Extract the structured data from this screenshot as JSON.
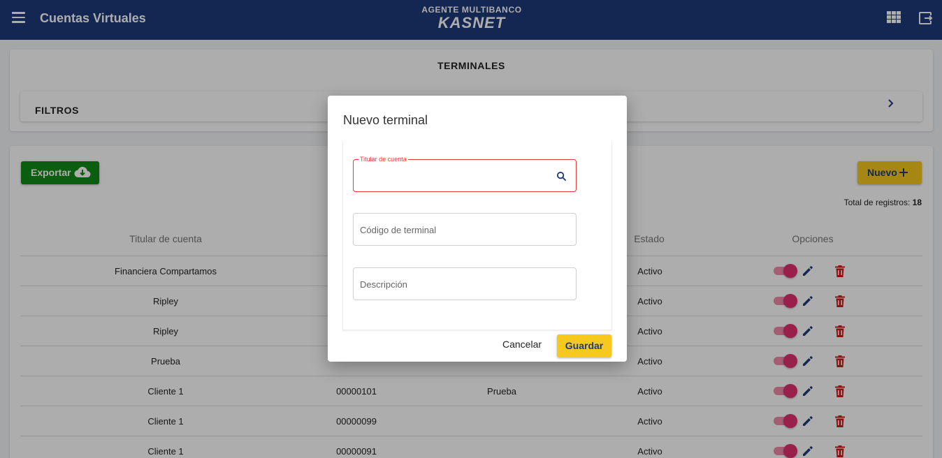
{
  "header": {
    "title": "Cuentas Virtuales",
    "logo_top": "AGENTE MULTIBANCO",
    "logo_main": "KASNET"
  },
  "top_card": {
    "title": "TERMINALES",
    "filters_label": "FILTROS"
  },
  "toolbar": {
    "export_label": "Exportar",
    "new_label": "Nuevo",
    "total_label": "Total de registros:",
    "total_value": "18"
  },
  "table": {
    "headers": {
      "holder": "Titular de cuenta",
      "status": "Estado",
      "options": "Opciones"
    },
    "rows": [
      {
        "holder": "Financiera Compartamos",
        "code": "",
        "description": "",
        "status": "Activo",
        "enabled": true
      },
      {
        "holder": "Ripley",
        "code": "",
        "description": "",
        "status": "Activo",
        "enabled": true
      },
      {
        "holder": "Ripley",
        "code": "",
        "description": "",
        "status": "Activo",
        "enabled": true
      },
      {
        "holder": "Prueba",
        "code": "",
        "description": "",
        "status": "Activo",
        "enabled": true
      },
      {
        "holder": "Cliente 1",
        "code": "00000101",
        "description": "Prueba",
        "status": "Activo",
        "enabled": true
      },
      {
        "holder": "Cliente 1",
        "code": "00000099",
        "description": "",
        "status": "Activo",
        "enabled": true
      },
      {
        "holder": "Cliente 1",
        "code": "00000091",
        "description": "",
        "status": "Activo",
        "enabled": true
      }
    ]
  },
  "dialog": {
    "title": "Nuevo terminal",
    "holder_float_label": "Titular de cuenta",
    "holder_value": "",
    "code_placeholder": "Código de terminal",
    "description_placeholder": "Descripción",
    "cancel_label": "Cancelar",
    "save_label": "Guardar"
  },
  "colors": {
    "header_bg": "#1e3a7b",
    "export_green": "#118a17",
    "accent_yellow": "#f7c81e",
    "toggle_pink": "#e2306f",
    "edit_blue": "#1e3a7b",
    "delete_red": "#d11a1a",
    "error_red": "#e53935"
  },
  "icons": [
    "menu-icon",
    "apps-icon",
    "logout-icon",
    "chevron-right-icon",
    "cloud-download-icon",
    "plus-icon",
    "edit-icon",
    "delete-icon",
    "search-icon"
  ]
}
